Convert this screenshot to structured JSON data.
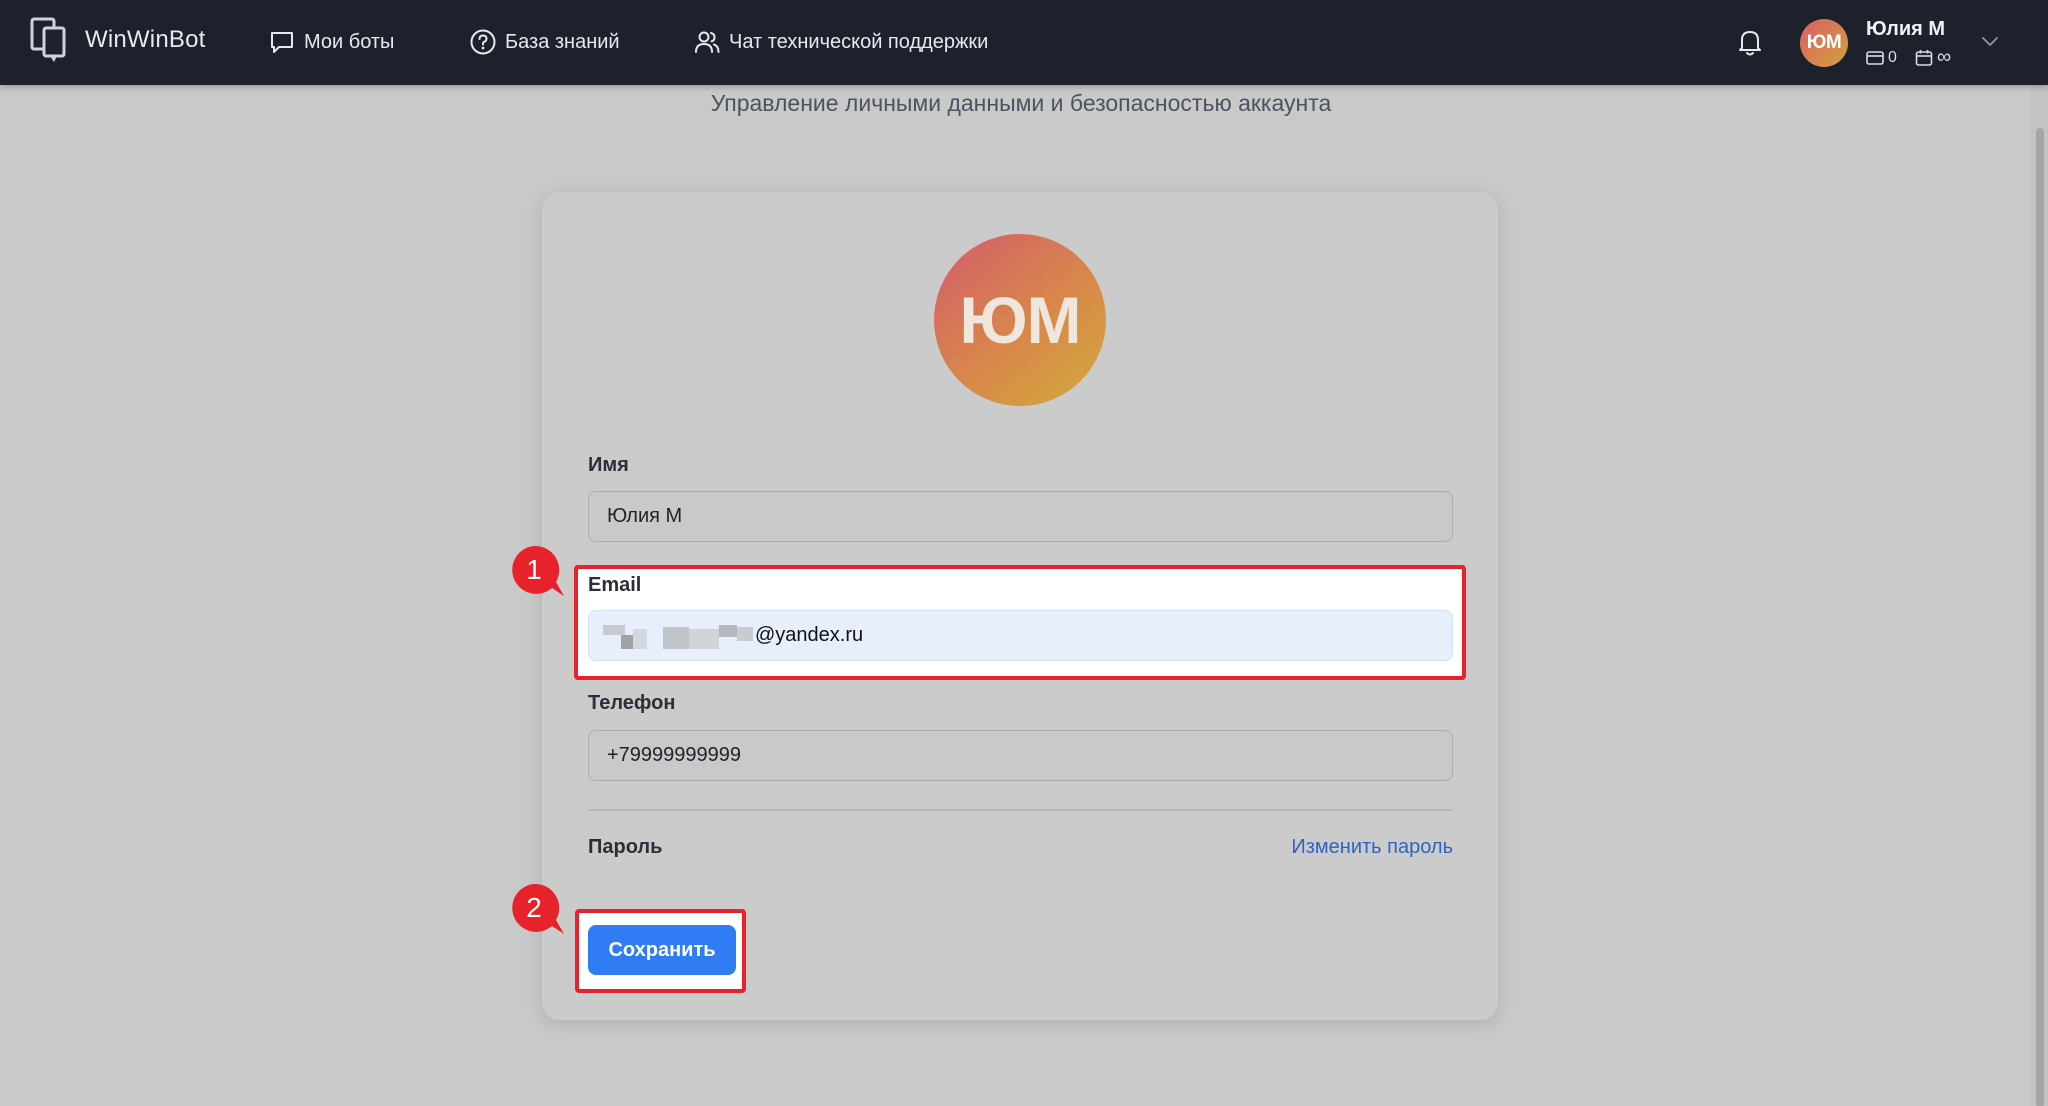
{
  "header": {
    "brand": "WinWinBot",
    "nav": [
      {
        "label": "Мои боты",
        "icon": "chat-bubble-icon"
      },
      {
        "label": "База знаний",
        "icon": "question-circle-icon"
      },
      {
        "label": "Чат технической поддержки",
        "icon": "users-icon"
      }
    ],
    "user": {
      "initials": "ЮМ",
      "name": "Юлия М",
      "balance": "0",
      "period": "∞"
    }
  },
  "page": {
    "subtitle": "Управление личными данными и безопасностью аккаунта"
  },
  "profile": {
    "avatar_initials": "ЮМ",
    "name_label": "Имя",
    "name_value": "Юлия М",
    "email_label": "Email",
    "email_visible_suffix": "@yandex.ru",
    "phone_label": "Телефон",
    "phone_value": "+79999999999",
    "password_label": "Пароль",
    "change_password_label": "Изменить пароль",
    "save_label": "Сохранить"
  },
  "annotations": {
    "marker_1": "1",
    "marker_2": "2"
  },
  "colors": {
    "topbar": "#1c212b",
    "accent": "#2f7cf5",
    "highlight": "#e8222a",
    "link": "#2f62c2"
  }
}
